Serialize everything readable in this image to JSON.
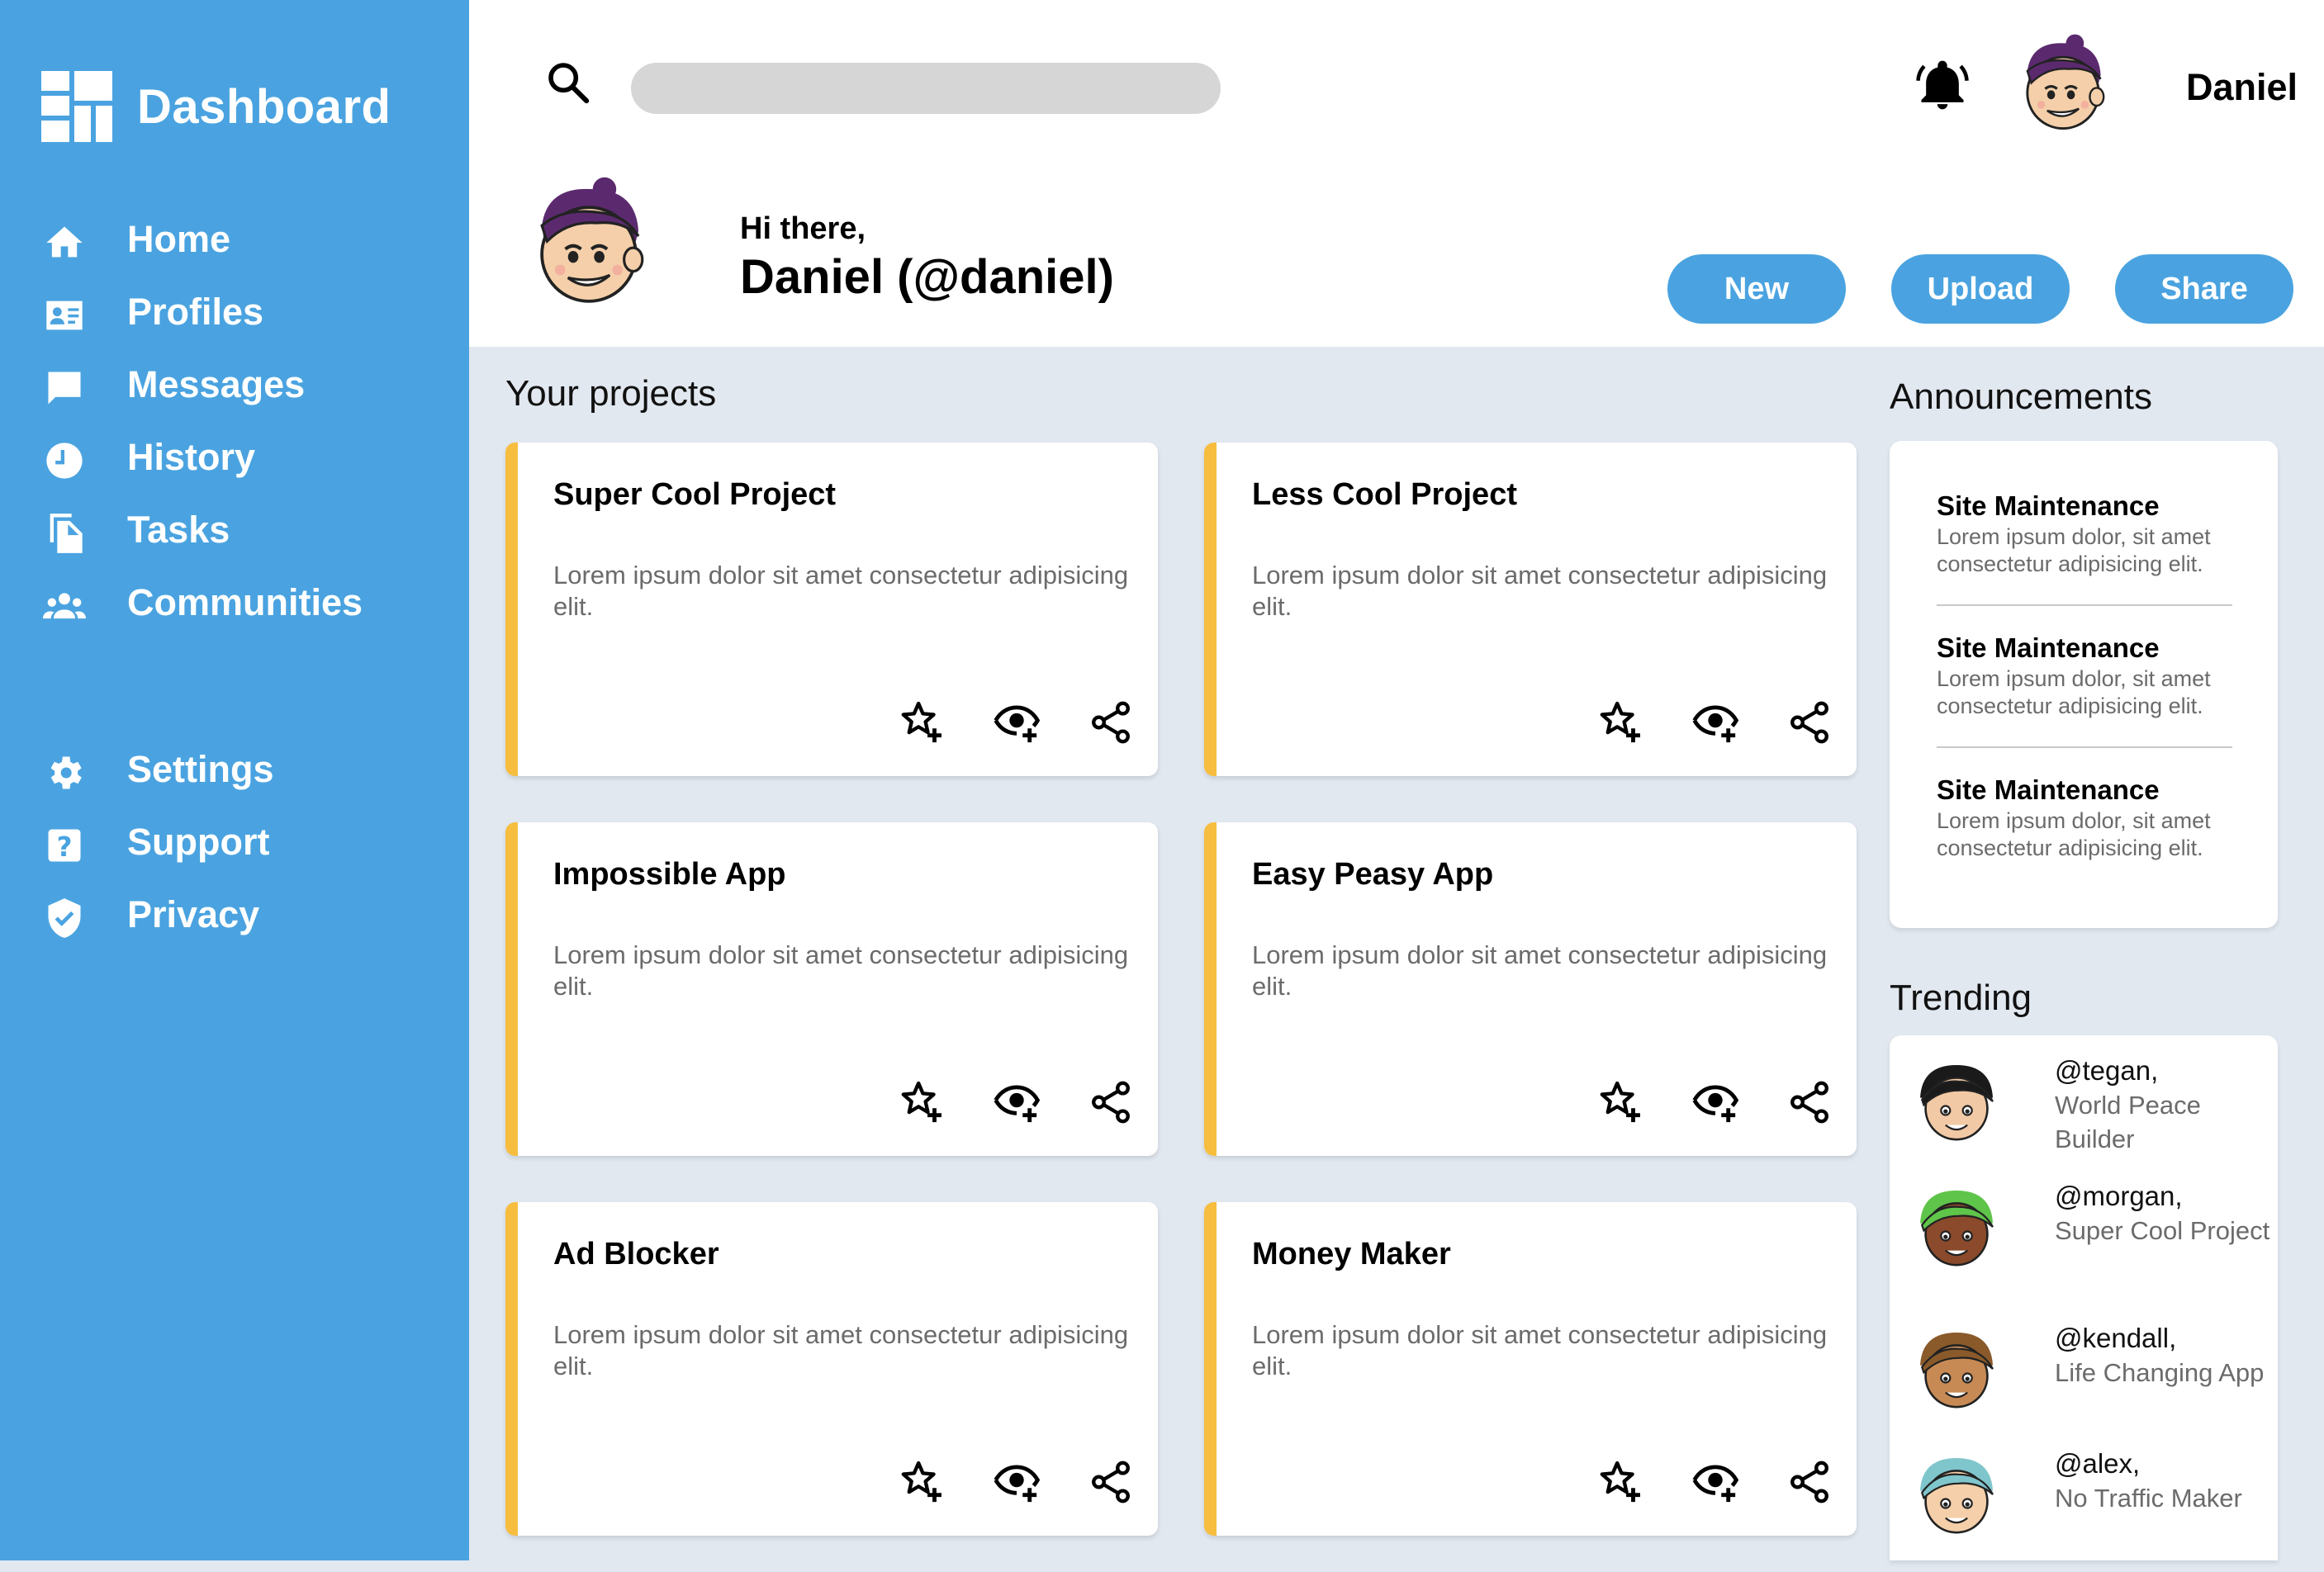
{
  "colors": {
    "sidebar": "#4aa3e0",
    "accent": "#f6bd3f",
    "button": "#4aa3e0",
    "background": "#e2e8f0"
  },
  "sidebar": {
    "brand": {
      "label": "Dashboard",
      "icon": "dashboard-grid-icon"
    },
    "main_items": [
      {
        "label": "Home",
        "icon": "home-icon"
      },
      {
        "label": "Profiles",
        "icon": "id-card-icon"
      },
      {
        "label": "Messages",
        "icon": "chat-icon"
      },
      {
        "label": "History",
        "icon": "clock-icon"
      },
      {
        "label": "Tasks",
        "icon": "document-icon"
      },
      {
        "label": "Communities",
        "icon": "group-icon"
      }
    ],
    "secondary_items": [
      {
        "label": "Settings",
        "icon": "gear-icon"
      },
      {
        "label": "Support",
        "icon": "help-icon"
      },
      {
        "label": "Privacy",
        "icon": "shield-icon"
      }
    ]
  },
  "header": {
    "search": {
      "value": "",
      "placeholder": ""
    },
    "username": "Daniel"
  },
  "hero": {
    "greeting": "Hi there,",
    "fullname": "Daniel (@daniel)",
    "buttons": {
      "new": "New",
      "upload": "Upload",
      "share": "Share"
    }
  },
  "projects": {
    "title": "Your projects",
    "items": [
      {
        "title": "Super Cool Project",
        "description": "Lorem ipsum dolor sit amet consectetur adipisicing elit."
      },
      {
        "title": "Less Cool Project",
        "description": "Lorem ipsum dolor sit amet consectetur adipisicing elit."
      },
      {
        "title": "Impossible App",
        "description": "Lorem ipsum dolor sit amet consectetur adipisicing elit."
      },
      {
        "title": "Easy Peasy App",
        "description": "Lorem ipsum dolor sit amet consectetur adipisicing elit."
      },
      {
        "title": "Ad Blocker",
        "description": "Lorem ipsum dolor sit amet consectetur adipisicing elit."
      },
      {
        "title": "Money Maker",
        "description": "Lorem ipsum dolor sit amet consectetur adipisicing elit."
      }
    ],
    "action_icons": [
      "star-add-icon",
      "watch-add-icon",
      "share-icon"
    ]
  },
  "announcements": {
    "title": "Announcements",
    "items": [
      {
        "title": "Site Maintenance",
        "body": "Lorem ipsum dolor, sit amet consectetur adipisicing elit."
      },
      {
        "title": "Site Maintenance",
        "body": "Lorem ipsum dolor, sit amet consectetur adipisicing elit."
      },
      {
        "title": "Site Maintenance",
        "body": "Lorem ipsum dolor, sit amet consectetur adipisicing elit."
      }
    ]
  },
  "trending": {
    "title": "Trending",
    "items": [
      {
        "handle": "@tegan,",
        "project": "World Peace Builder",
        "hair": "#1a1a1a",
        "skin": "#f2c9a5"
      },
      {
        "handle": "@morgan,",
        "project": "Super Cool Project",
        "hair": "#5fc44a",
        "skin": "#8a4a2b"
      },
      {
        "handle": "@kendall,",
        "project": "Life Changing App",
        "hair": "#8a5a2b",
        "skin": "#c88a55"
      },
      {
        "handle": "@alex,",
        "project": "No Traffic Maker",
        "hair": "#7fc6cc",
        "skin": "#f4cfa9"
      }
    ]
  }
}
